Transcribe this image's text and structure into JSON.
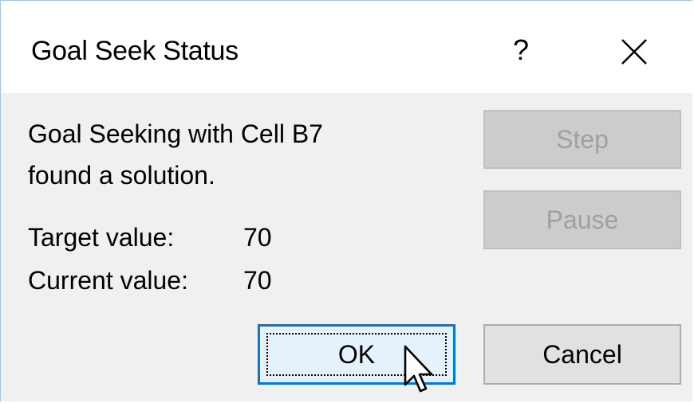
{
  "dialog": {
    "title": "Goal Seek Status",
    "help_label": "?",
    "close_icon": "close-icon"
  },
  "message": {
    "line1": "Goal Seeking with Cell B7",
    "line2": "found a solution."
  },
  "target": {
    "label": "Target value:",
    "value": "70"
  },
  "current": {
    "label": "Current value:",
    "value": "70"
  },
  "buttons": {
    "step": "Step",
    "pause": "Pause",
    "ok": "OK",
    "cancel": "Cancel"
  },
  "colors": {
    "accent": "#0078d7",
    "dialog_bg": "#f0f0f0",
    "disabled_bg": "#cccccc"
  }
}
